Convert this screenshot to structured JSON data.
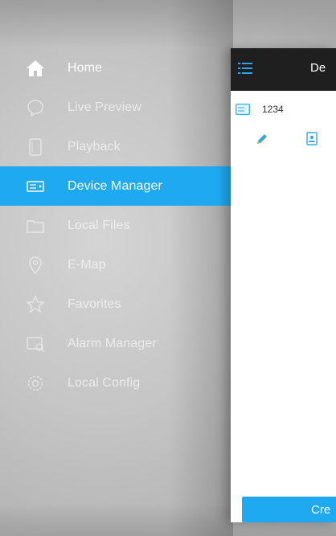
{
  "menu": {
    "items": [
      {
        "label": "Home",
        "icon": "home-icon"
      },
      {
        "label": "Live Preview",
        "icon": "live-preview-icon"
      },
      {
        "label": "Playback",
        "icon": "playback-icon"
      },
      {
        "label": "Device Manager",
        "icon": "device-manager-icon",
        "active": true
      },
      {
        "label": "Local Files",
        "icon": "folder-icon"
      },
      {
        "label": "E-Map",
        "icon": "map-pin-icon"
      },
      {
        "label": "Favorites",
        "icon": "star-icon"
      },
      {
        "label": "Alarm Manager",
        "icon": "alarm-icon"
      },
      {
        "label": "Local Config",
        "icon": "gear-icon"
      }
    ]
  },
  "panel": {
    "title": "De",
    "device_name": "1234",
    "create_label": "Cre"
  },
  "colors": {
    "accent": "#1fa9ef",
    "header": "#1f1f1f"
  }
}
